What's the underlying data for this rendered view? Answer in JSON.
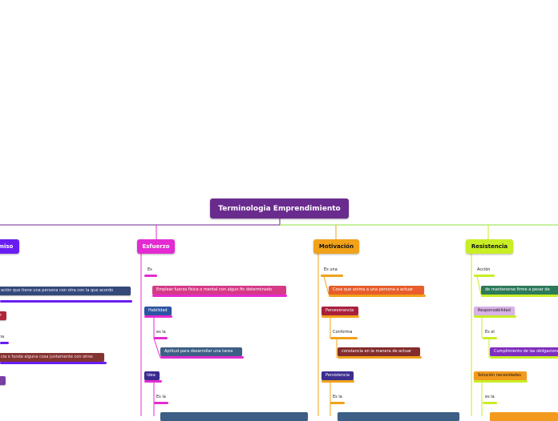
{
  "root": {
    "title": "Terminologia Emprendimiento"
  },
  "colors": {
    "compromiso": "#6a1df2",
    "esfuerzo": "#e42ad2",
    "motivacion": "#f1a21a",
    "resistencia": "#c9ee26",
    "root": "#6a2b8e"
  },
  "branches": {
    "compromiso": {
      "title": "miso",
      "items": [
        {
          "text": "ación que tiene una persona con otra con la que acordo"
        },
        {
          "text": "ar"
        },
        {
          "text": "na"
        },
        {
          "text": "cia o funda alguna cosa juntamente con otros"
        },
        {
          "text": "o"
        }
      ]
    },
    "esfuerzo": {
      "title": "Esfuerzo",
      "items": [
        {
          "text": "Es"
        },
        {
          "text": "Emplear fuerza física o mental con algun fin determinado"
        },
        {
          "text": "Habilidad"
        },
        {
          "text": "es la"
        },
        {
          "text": "Aptitud para desarrollar una tarea"
        },
        {
          "text": "Idea"
        },
        {
          "text": "Es la"
        }
      ]
    },
    "motivacion": {
      "title": "Motivación",
      "items": [
        {
          "text": "Es una"
        },
        {
          "text": "Cosa que anima a una persona a actuar"
        },
        {
          "text": "Perseverancia"
        },
        {
          "text": "Conforma"
        },
        {
          "text": "constancia en la manera de actuar"
        },
        {
          "text": "Persistencia"
        },
        {
          "text": "Es la"
        }
      ]
    },
    "resistencia": {
      "title": "Resistencia",
      "items": [
        {
          "text": "Acción"
        },
        {
          "text": "de mantenerse firme a pesar de"
        },
        {
          "text": "Responsabilidad"
        },
        {
          "text": "Es el"
        },
        {
          "text": "Cumplimiento de las obligaciones"
        },
        {
          "text": "Solución necesidades"
        },
        {
          "text": "es la"
        }
      ]
    }
  }
}
